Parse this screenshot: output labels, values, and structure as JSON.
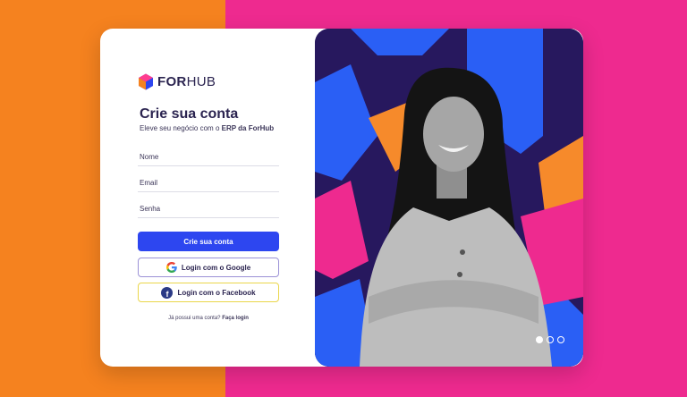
{
  "brand": {
    "logo_prefix": "FOR",
    "logo_suffix": "HUB"
  },
  "form": {
    "title": "Crie sua conta",
    "subtitle_prefix": "Eleve seu negócio com o ",
    "subtitle_bold": "ERP da ForHub",
    "fields": [
      {
        "placeholder": "Nome",
        "value": ""
      },
      {
        "placeholder": "Email",
        "value": ""
      },
      {
        "placeholder": "Senha",
        "value": ""
      }
    ],
    "submit_label": "Crie sua conta",
    "google_label": "Login com o Google",
    "facebook_label": "Login com o Facebook",
    "login_prompt": "Já possui uma conta? ",
    "login_link": "Faça login"
  },
  "carousel": {
    "slides": 3,
    "active_index": 0
  },
  "colors": {
    "left_background": "#f5821f",
    "right_background": "#ee2a8f",
    "primary_button": "#2d46f0",
    "text_dark": "#2b2450",
    "hero_shape_blue": "#2a5ff5",
    "hero_shape_pink": "#ee2a8f",
    "hero_shape_orange": "#f68a2b"
  },
  "icons": [
    "forhub-logo-icon",
    "google-icon",
    "facebook-icon"
  ]
}
